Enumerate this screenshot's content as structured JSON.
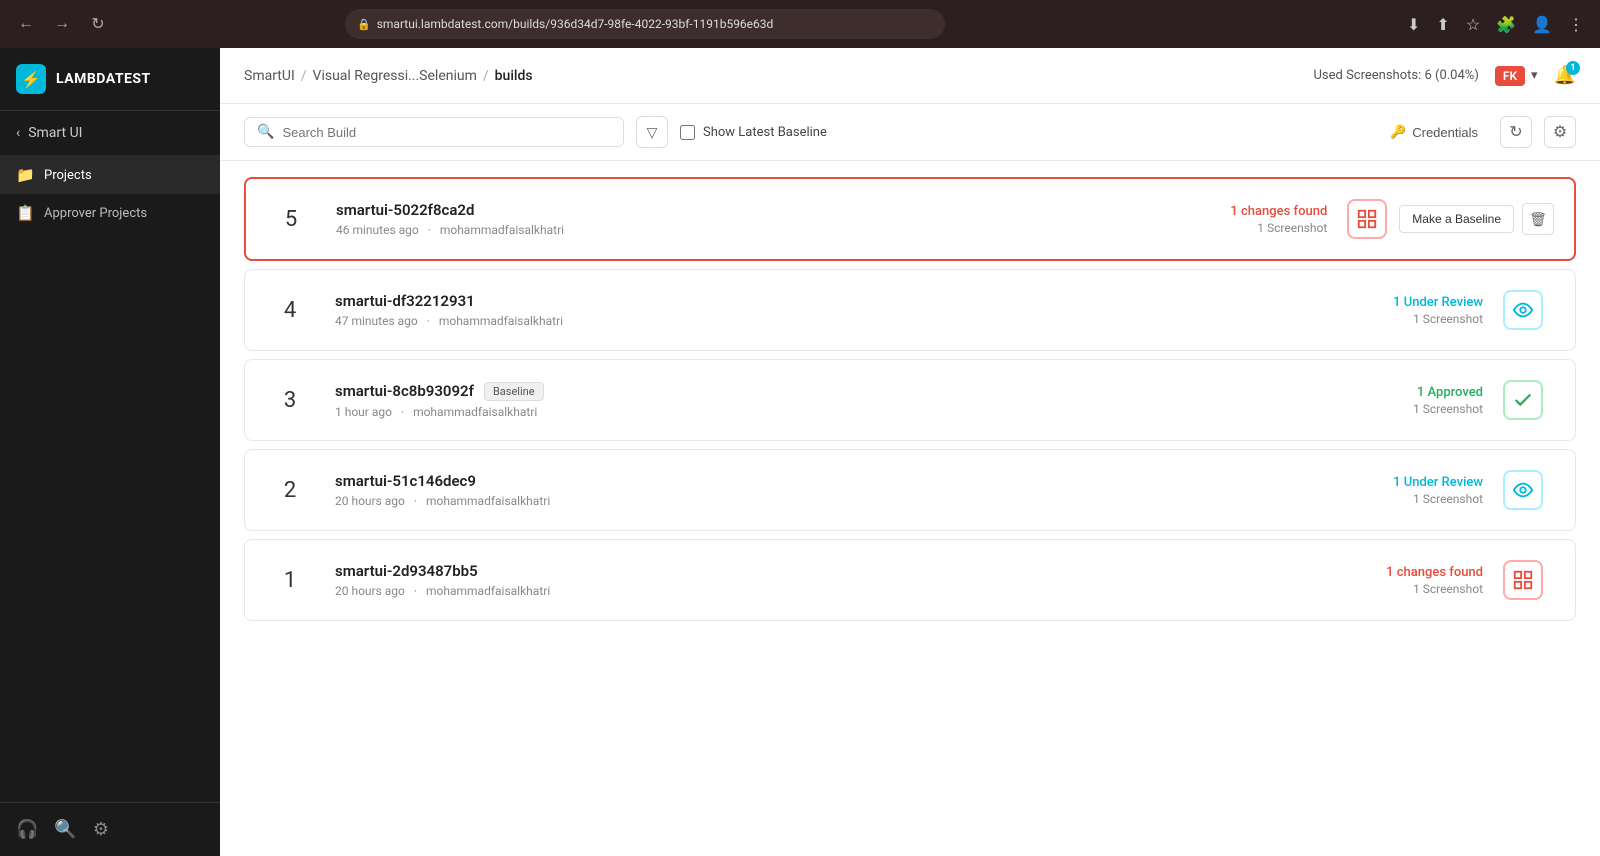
{
  "browser": {
    "url": "smartui.lambdatest.com/builds/936d34d7-98fe-4022-93bf-1191b596e63d",
    "back_title": "Back",
    "forward_title": "Forward",
    "reload_title": "Reload"
  },
  "sidebar": {
    "logo_text": "LAMBDATEST",
    "back_label": "Smart UI",
    "nav_items": [
      {
        "label": "Projects",
        "icon": "📁"
      },
      {
        "label": "Approver Projects",
        "icon": "📋"
      }
    ],
    "footer_icons": [
      "headset",
      "search",
      "settings"
    ]
  },
  "header": {
    "breadcrumb": {
      "part1": "SmartUI",
      "sep1": "/",
      "part2": "Visual Regressi...Selenium",
      "sep2": "/",
      "part3": "builds"
    },
    "used_screenshots": "Used Screenshots: 6 (0.04%)",
    "user_initials": "FK",
    "notification_count": "1"
  },
  "toolbar": {
    "search_placeholder": "Search Build",
    "baseline_label": "Show Latest Baseline",
    "credentials_label": "Credentials",
    "refresh_title": "Refresh",
    "settings_title": "Settings"
  },
  "builds": [
    {
      "number": "5",
      "id": "smartui-5022f8ca2d",
      "time": "46 minutes ago",
      "author": "mohammadfaisalkhatri",
      "status_label": "1 changes found",
      "screenshot_label": "1 Screenshot",
      "status_type": "changes",
      "highlighted": true,
      "is_baseline": false,
      "show_actions": true
    },
    {
      "number": "4",
      "id": "smartui-df32212931",
      "time": "47 minutes ago",
      "author": "mohammadfaisalkhatri",
      "status_label": "1 Under Review",
      "screenshot_label": "1 Screenshot",
      "status_type": "review",
      "highlighted": false,
      "is_baseline": false,
      "show_actions": false
    },
    {
      "number": "3",
      "id": "smartui-8c8b93092f",
      "time": "1 hour ago",
      "author": "mohammadfaisalkhatri",
      "status_label": "1 Approved",
      "screenshot_label": "1 Screenshot",
      "status_type": "approved",
      "highlighted": false,
      "is_baseline": true,
      "show_actions": false
    },
    {
      "number": "2",
      "id": "smartui-51c146dec9",
      "time": "20 hours ago",
      "author": "mohammadfaisalkhatri",
      "status_label": "1 Under Review",
      "screenshot_label": "1 Screenshot",
      "status_type": "review",
      "highlighted": false,
      "is_baseline": false,
      "show_actions": false
    },
    {
      "number": "1",
      "id": "smartui-2d93487bb5",
      "time": "20 hours ago",
      "author": "mohammadfaisalkhatri",
      "status_label": "1 changes found",
      "screenshot_label": "1 Screenshot",
      "status_type": "changes",
      "highlighted": false,
      "is_baseline": false,
      "show_actions": false
    }
  ],
  "icons": {
    "changes_icon": "⊞",
    "review_icon": "👁",
    "approved_icon": "✓",
    "key_icon": "🔑",
    "refresh_icon": "↻",
    "settings_icon": "⚙",
    "filter_icon": "▽",
    "search_icon": "🔍",
    "back_arrow": "←",
    "forward_arrow": "→",
    "trash_icon": "🗑",
    "baseline_badge": "Baseline"
  }
}
